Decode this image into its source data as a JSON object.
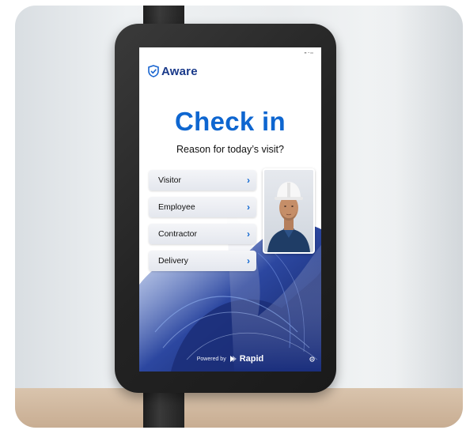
{
  "brand": {
    "name": "Aware"
  },
  "checkin": {
    "title": "Check in",
    "subtitle": "Reason for today’s visit?"
  },
  "options": [
    {
      "label": "Visitor",
      "icon": "chevron-right-icon"
    },
    {
      "label": "Employee",
      "icon": "chevron-right-icon"
    },
    {
      "label": "Contractor",
      "icon": "chevron-right-icon"
    },
    {
      "label": "Delivery",
      "icon": "chevron-right-icon"
    }
  ],
  "footer": {
    "powered_by": "Powered by",
    "provider": "Rapid"
  },
  "colors": {
    "accent": "#0e66d0",
    "brand_navy": "#1a3a8a",
    "background_swirl": "#1c2f7a"
  }
}
